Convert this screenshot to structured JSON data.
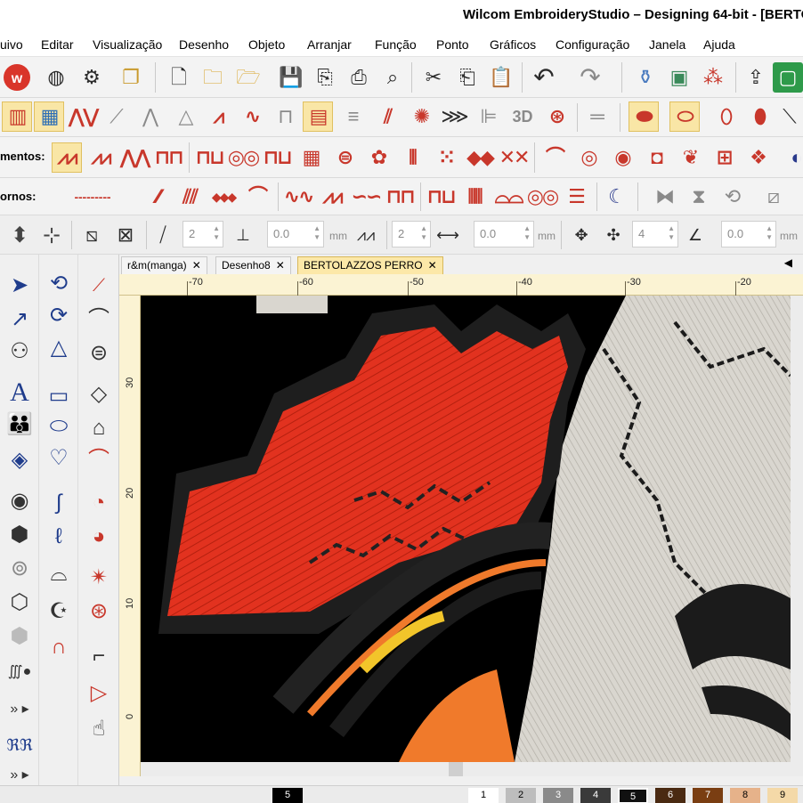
{
  "window": {
    "title": "Wilcom EmbroideryStudio – Designing 64-bit - [BERTO"
  },
  "menu": [
    {
      "label": "uivo"
    },
    {
      "label": "Editar"
    },
    {
      "label": "Visualização"
    },
    {
      "label": "Desenho"
    },
    {
      "label": "Objeto"
    },
    {
      "label": "Arranjar"
    },
    {
      "label": "Função"
    },
    {
      "label": "Ponto"
    },
    {
      "label": "Gráficos"
    },
    {
      "label": "Configuração"
    },
    {
      "label": "Janela"
    },
    {
      "label": "Ajuda"
    }
  ],
  "toolbars": {
    "stitch_types_label": "mentos:",
    "outlines_label": "ornos:",
    "badge_3d": "3D"
  },
  "properties": {
    "field_a": "2",
    "field_b": "0.0",
    "unit_b": "mm",
    "field_c": "2",
    "field_d": "0.0",
    "unit_d": "mm",
    "field_e": "4",
    "field_f": "0.0",
    "unit_f": "mm"
  },
  "tabs": [
    {
      "label": "r&m(manga)",
      "active": false
    },
    {
      "label": "Desenho8",
      "active": false
    },
    {
      "label": "BERTOLAZZOS PERRO",
      "active": true
    }
  ],
  "rulers": {
    "horizontal": [
      "-70",
      "-60",
      "-50",
      "-40",
      "-30",
      "-20"
    ],
    "vertical": [
      "30",
      "20",
      "10",
      "0"
    ]
  },
  "palette": [
    "5",
    "1",
    "2",
    "3",
    "4",
    "5",
    "6",
    "7",
    "8",
    "9"
  ],
  "colors": {
    "thread_red": "#e2321f",
    "thread_orange": "#f07a2b",
    "thread_yellow": "#f2c52a",
    "thread_white": "#d9d6cf",
    "thread_black": "#1b1b1b",
    "tab_active": "#fce8a8",
    "ruler": "#fbf3d3"
  },
  "icons": [
    "wilcom-logo-icon",
    "globe-icon",
    "shapes-icon",
    "copy-icon",
    "new-file-icon",
    "open-folder-icon",
    "save-icon",
    "print-icon",
    "zoom-icon",
    "cut-icon",
    "paste-icon",
    "undo-icon",
    "redo-icon",
    "select-icon",
    "text-icon",
    "ellipse-icon"
  ]
}
